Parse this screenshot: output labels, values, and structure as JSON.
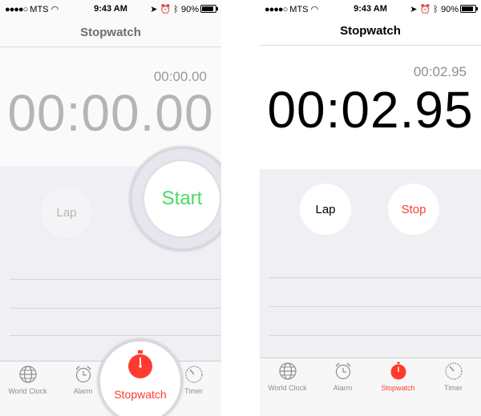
{
  "status": {
    "carrier": "MTS",
    "time": "9:43 AM",
    "battery": "90%"
  },
  "nav": {
    "title": "Stopwatch"
  },
  "left_screen": {
    "small_time": "00:00.00",
    "big_time": "00:00.00",
    "lap_label": "Lap",
    "start_label": "Start"
  },
  "right_screen": {
    "small_time": "00:02.95",
    "big_time": "00:02.95",
    "lap_label": "Lap",
    "stop_label": "Stop"
  },
  "tabs": [
    {
      "label": "World Clock",
      "icon": "globe-icon"
    },
    {
      "label": "Alarm",
      "icon": "alarm-clock-icon"
    },
    {
      "label": "Stopwatch",
      "icon": "stopwatch-icon"
    },
    {
      "label": "Timer",
      "icon": "timer-icon"
    }
  ],
  "colors": {
    "start_green": "#4cd964",
    "stop_red": "#ff3b30",
    "active_tab": "#ff3b30",
    "inactive_tab": "#8e8e93"
  }
}
